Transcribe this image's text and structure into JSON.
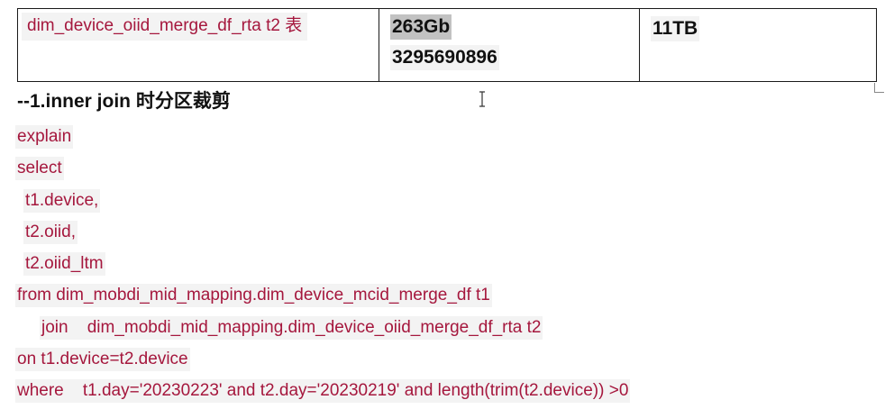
{
  "table": {
    "name": "dim_device_oiid_merge_df_rta   t2 表",
    "size": "263Gb",
    "rows": "3295690896",
    "total": "11TB"
  },
  "heading": "--1.inner join 时分区裁剪",
  "code": [
    "explain",
    "select",
    "t1.device,",
    "t2.oiid,",
    "t2.oiid_ltm",
    "from dim_mobdi_mid_mapping.dim_device_mcid_merge_df t1",
    "join    dim_mobdi_mid_mapping.dim_device_oiid_merge_df_rta t2",
    "on t1.device=t2.device",
    "where    t1.day='20230223' and t2.day='20230219' and length(trim(t2.device)) >0"
  ],
  "colors": {
    "code_text": "#a5173d",
    "code_bg": "#f3f3f3",
    "highlight_bg": "#c2c2c2"
  }
}
